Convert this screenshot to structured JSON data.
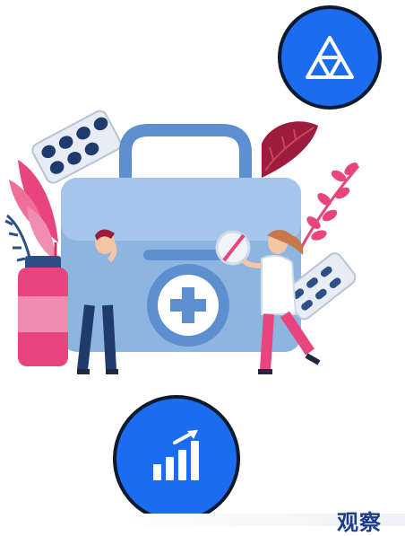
{
  "colors": {
    "accent_blue": "#1c6cf0",
    "ring": "#0d1a2e",
    "kit_blue": "#8eb4e0",
    "kit_dark": "#5d8ed0",
    "pink": "#e8457e",
    "maroon": "#9d1c3b",
    "headline": "#1d3c8c"
  },
  "icons": {
    "top_button_icon": "triangle-network-icon",
    "bottom_button_icon": "growth-chart-icon"
  },
  "footer": {
    "partial_text": "观察"
  }
}
